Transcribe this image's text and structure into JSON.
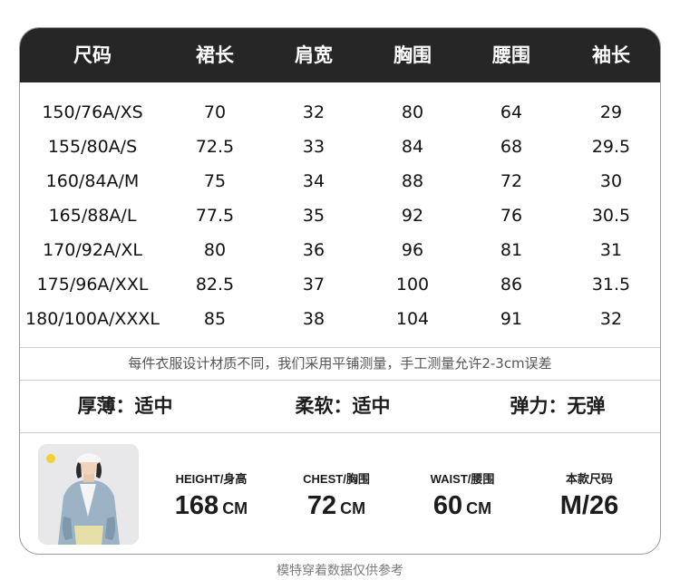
{
  "table": {
    "headers": [
      "尺码",
      "裙长",
      "肩宽",
      "胸围",
      "腰围",
      "袖长"
    ],
    "rows": [
      [
        "150/76A/XS",
        "70",
        "32",
        "80",
        "64",
        "29"
      ],
      [
        "155/80A/S",
        "72.5",
        "33",
        "84",
        "68",
        "29.5"
      ],
      [
        "160/84A/M",
        "75",
        "34",
        "88",
        "72",
        "30"
      ],
      [
        "165/88A/L",
        "77.5",
        "35",
        "92",
        "76",
        "30.5"
      ],
      [
        "170/92A/XL",
        "80",
        "36",
        "96",
        "81",
        "31"
      ],
      [
        "175/96A/XXL",
        "82.5",
        "37",
        "100",
        "86",
        "31.5"
      ],
      [
        "180/100A/XXXL",
        "85",
        "38",
        "104",
        "91",
        "32"
      ]
    ]
  },
  "note": "每件衣服设计材质不同，我们采用平铺测量，手工测量允许2-3cm误差",
  "attributes": [
    {
      "text": "厚薄：适中"
    },
    {
      "text": "柔软：适中"
    },
    {
      "text": "弹力：无弹"
    }
  ],
  "model": {
    "height": {
      "label": "HEIGHT/身高",
      "value": "168",
      "unit": "CM"
    },
    "chest": {
      "label": "CHEST/胸围",
      "value": "72",
      "unit": "CM"
    },
    "waist": {
      "label": "WAIST/腰围",
      "value": "60",
      "unit": "CM"
    },
    "size": {
      "label": "本款尺码",
      "value": "M/26"
    }
  },
  "footer": "模特穿着数据仅供参考",
  "colors": {
    "header_bg": "#262626",
    "header_text": "#ffffff",
    "border": "#9a9a9a"
  }
}
